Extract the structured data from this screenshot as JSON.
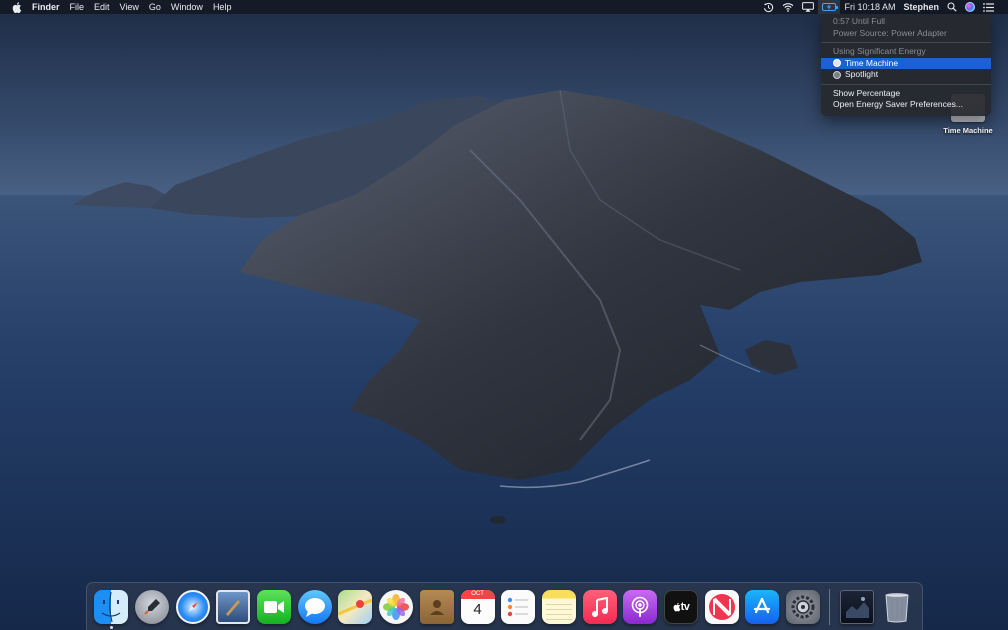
{
  "menubar": {
    "app_name": "Finder",
    "menus": [
      "File",
      "Edit",
      "View",
      "Go",
      "Window",
      "Help"
    ],
    "clock": "Fri 10:18 AM",
    "user": "Stephen",
    "status_icons": [
      "time-machine-icon",
      "wifi-icon",
      "airplay-icon",
      "battery-charging-icon",
      "spotlight-search-icon",
      "siri-icon",
      "notification-center-icon"
    ]
  },
  "battery_menu": {
    "time_until_full": "0:57 Until Full",
    "power_source": "Power Source: Power Adapter",
    "significant_energy_header": "Using Significant Energy",
    "apps": [
      "Time Machine",
      "Spotlight"
    ],
    "show_percentage": "Show Percentage",
    "open_prefs": "Open Energy Saver Preferences..."
  },
  "desktop_icons": [
    {
      "label": "Time Machine"
    }
  ],
  "dock": {
    "apps": [
      {
        "name": "Finder",
        "icon": "finder-icon",
        "running": true
      },
      {
        "name": "Launchpad",
        "icon": "launchpad-icon",
        "running": false
      },
      {
        "name": "Safari",
        "icon": "safari-icon",
        "running": false
      },
      {
        "name": "Mail",
        "icon": "mail-icon",
        "running": false
      },
      {
        "name": "FaceTime",
        "icon": "facetime-icon",
        "running": false
      },
      {
        "name": "Messages",
        "icon": "messages-icon",
        "running": false
      },
      {
        "name": "Maps",
        "icon": "maps-icon",
        "running": false
      },
      {
        "name": "Photos",
        "icon": "photos-icon",
        "running": false
      },
      {
        "name": "Contacts",
        "icon": "contacts-icon",
        "running": false
      },
      {
        "name": "Calendar",
        "icon": "calendar-icon",
        "running": false,
        "month": "OCT",
        "day": "4"
      },
      {
        "name": "Reminders",
        "icon": "reminders-icon",
        "running": false
      },
      {
        "name": "Notes",
        "icon": "notes-icon",
        "running": false
      },
      {
        "name": "Music",
        "icon": "music-icon",
        "running": false
      },
      {
        "name": "Podcasts",
        "icon": "podcasts-icon",
        "running": false
      },
      {
        "name": "TV",
        "icon": "tv-icon",
        "running": false,
        "label": "tv"
      },
      {
        "name": "News",
        "icon": "news-icon",
        "running": false
      },
      {
        "name": "App Store",
        "icon": "app-store-icon",
        "running": false
      },
      {
        "name": "System Preferences",
        "icon": "system-preferences-icon",
        "running": false
      }
    ],
    "stack": {
      "name": "Downloads",
      "icon": "downloads-stack-icon"
    },
    "trash": {
      "name": "Trash",
      "icon": "trash-icon"
    }
  },
  "colors": {
    "menu_highlight": "#1a62d4",
    "battery_charging": "#4aa3ff",
    "ocean": "#1f3556",
    "sky": "#2f4563"
  }
}
